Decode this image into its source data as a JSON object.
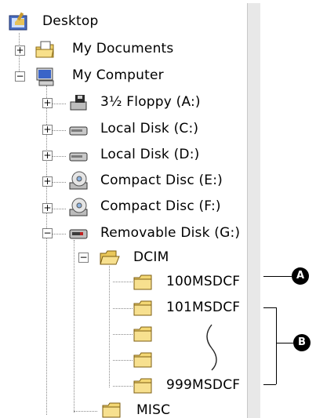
{
  "tree": {
    "root": "Desktop",
    "my_documents": "My Documents",
    "my_computer": "My Computer",
    "drives": [
      "3½ Floppy (A:)",
      "Local Disk (C:)",
      "Local Disk (D:)",
      "Compact Disc (E:)",
      "Compact Disc (F:)",
      "Removable Disk (G:)"
    ],
    "dcim": "DCIM",
    "folders": [
      "100MSDCF",
      "101MSDCF",
      "999MSDCF"
    ],
    "misc": "MISC"
  },
  "callouts": {
    "a": "A",
    "b": "B"
  },
  "expanders": {
    "plus": "+",
    "minus": "−"
  },
  "ellipsis_glyph": "( )"
}
